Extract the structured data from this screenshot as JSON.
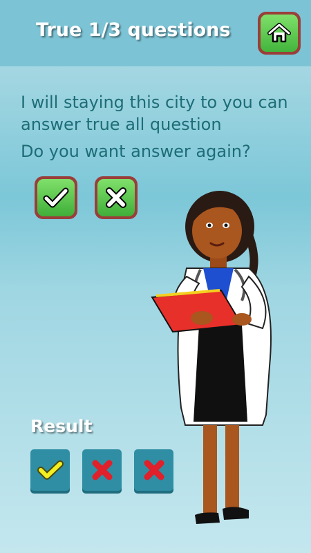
{
  "header": {
    "title": "True 1/3 questions",
    "home_icon": "home-icon"
  },
  "dialog": {
    "message": "I will staying this city to you can answer true all question",
    "question": "Do you want answer again?",
    "yes_icon": "checkmark-icon",
    "no_icon": "cross-icon"
  },
  "result": {
    "label": "Result",
    "answers": [
      "correct",
      "wrong",
      "wrong"
    ]
  },
  "colors": {
    "text_teal": "#1d6d76",
    "button_green": "#55c04a",
    "button_border": "#9a3e3a",
    "correct_mark": "#f4f020",
    "wrong_mark": "#e0202a"
  }
}
